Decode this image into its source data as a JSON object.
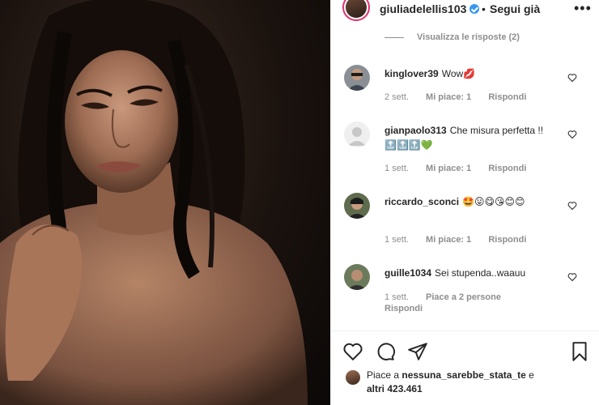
{
  "post": {
    "username": "giuliadelellis103",
    "separator": "•",
    "follow_label": "Segui già",
    "more_label": "•••"
  },
  "view_replies": "Visualizza le risposte (2)",
  "comments": [
    {
      "username": "kinglover39",
      "text": "Wow💋",
      "time": "2 sett.",
      "likes": "Mi piace: 1",
      "reply": "Rispondi"
    },
    {
      "username": "gianpaolo313",
      "text": "Che misura perfetta !!🔝🔝🔝💚",
      "time": "1 sett.",
      "likes": "Mi piace: 1",
      "reply": "Rispondi"
    },
    {
      "username": "riccardo_sconci",
      "text": "🤩😛😋😘😊😊",
      "time": "1 sett.",
      "likes": "Mi piace: 1",
      "reply": "Rispondi"
    },
    {
      "username": "guille1034",
      "text": "Sei stupenda..waauu",
      "time": "1 sett.",
      "likes": "Piace a 2 persone",
      "reply": "Rispondi"
    }
  ],
  "liked_by": {
    "prefix": "Piace a",
    "user": "nessuna_sarebbe_stata_te",
    "connector": "e",
    "others": "altri 423.461"
  },
  "icons": {
    "like": "heart-icon",
    "comment": "comment-icon",
    "share": "share-icon",
    "save": "bookmark-icon",
    "verified": "verified-badge-icon"
  },
  "colors": {
    "text": "#262626",
    "muted": "#8e8e8e",
    "verified": "#3897f0",
    "story_ring": "#e1306c"
  }
}
